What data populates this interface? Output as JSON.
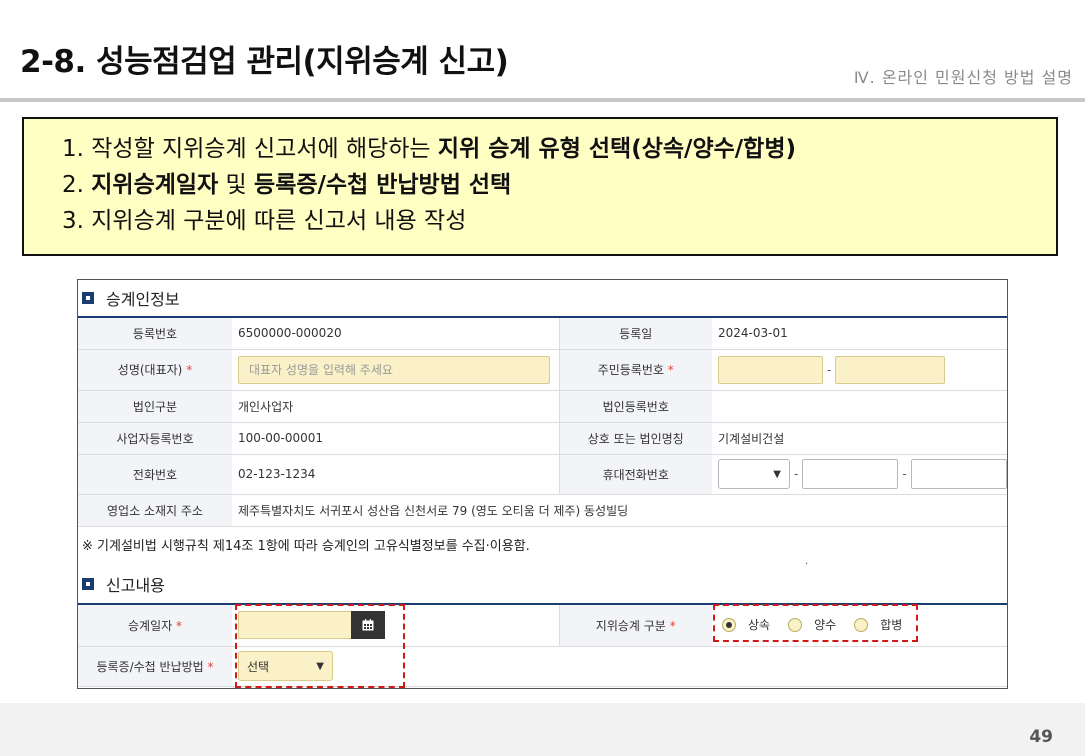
{
  "header": {
    "title": "2-8. 성능점검업 관리(지위승계 신고)",
    "subtitle": "Ⅳ. 온라인 민원신청 방법 설명"
  },
  "instructions": {
    "line1_prefix": "1. 작성할 지위승계 신고서에 해당하는 ",
    "line1_bold": "지위 승계 유형 선택(상속/양수/합병)",
    "line2_prefix": "2. ",
    "line2_bold1": "지위승계일자",
    "line2_mid": " 및 ",
    "line2_bold2": "등록증/수첩 반납방법 선택",
    "line3": "3. 지위승계 구분에 따른 신고서 내용 작성"
  },
  "section1": {
    "title": "승계인정보",
    "reg_no_label": "등록번호",
    "reg_no_value": "6500000-000020",
    "reg_date_label": "등록일",
    "reg_date_value": "2024-03-01",
    "name_label": "성명(대표자)",
    "name_placeholder": "대표자 성명을 입력해 주세요",
    "rrn_label": "주민등록번호",
    "corp_type_label": "법인구분",
    "corp_type_value": "개인사업자",
    "corp_reg_label": "법인등록번호",
    "corp_reg_value": "",
    "biz_no_label": "사업자등록번호",
    "biz_no_value": "100-00-00001",
    "company_label": "상호 또는 법인명칭",
    "company_value": "기계설비건설",
    "phone_label": "전화번호",
    "phone_value": "02-123-1234",
    "mobile_label": "휴대전화번호",
    "address_label": "영업소 소재지 주소",
    "address_value": "제주특별자치도 서귀포시 성산읍 신천서로 79 (영도 오티움 더 제주) 동성빌딩"
  },
  "note": "※ 기계설비법 시행규칙 제14조 1항에 따라 승계인의 고유식별정보를 수집·이용함.",
  "section2": {
    "title": "신고내용",
    "succession_date_label": "승계일자",
    "succession_type_label": "지위승계 구분",
    "radio_options": [
      "상속",
      "양수",
      "합병"
    ],
    "selected_option": "상속",
    "return_method_label": "등록증/수첩 반납방법",
    "return_method_value": "선택"
  },
  "required_mark": "*",
  "dash": "-",
  "page_number": "49",
  "colors": {
    "instruction_bg": "#ffffc4",
    "highlight_border": "#d01a1a",
    "section_rule": "#1a3c6e",
    "input_yellow": "#faf1c8"
  }
}
